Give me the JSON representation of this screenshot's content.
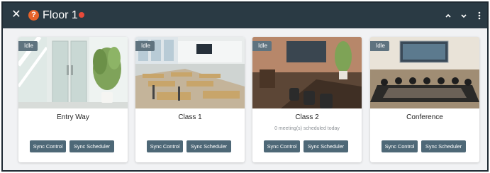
{
  "header": {
    "title": "Floor 1",
    "question_mark": "?",
    "background_color": "#2a3a44",
    "icons": [
      "close-icon",
      "help-icon",
      "warning-icon",
      "chevron-up-icon",
      "chevron-down-icon",
      "more-vertical-icon"
    ]
  },
  "rooms": [
    {
      "name": "Entry Way",
      "status": "Idle",
      "schedule_text": "",
      "sync_control_label": "Sync Control",
      "sync_scheduler_label": "Sync Scheduler"
    },
    {
      "name": "Class 1",
      "status": "Idle",
      "schedule_text": "",
      "sync_control_label": "Sync Control",
      "sync_scheduler_label": "Sync Scheduler"
    },
    {
      "name": "Class 2",
      "status": "Idle",
      "schedule_text": "0 meeting(s) scheduled today",
      "sync_control_label": "Sync Control",
      "sync_scheduler_label": "Sync Scheduler"
    },
    {
      "name": "Conference",
      "status": "Idle",
      "schedule_text": "",
      "sync_control_label": "Sync Control",
      "sync_scheduler_label": "Sync Scheduler"
    }
  ],
  "colors": {
    "accent": "#e7632a",
    "button": "#4e6877",
    "status_badge": "#5f737f"
  }
}
